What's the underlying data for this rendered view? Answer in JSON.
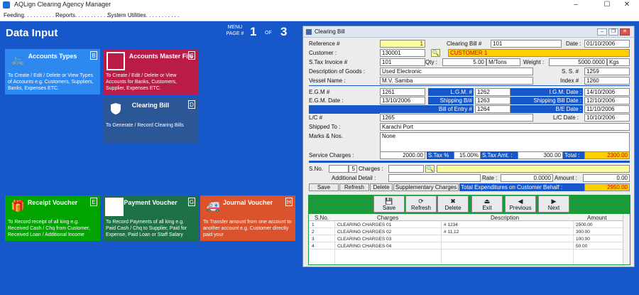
{
  "app": {
    "title": "AQLign Clearing Agency Manager"
  },
  "window_controls": {
    "minimize": "–",
    "maximize": "☐",
    "close": "✕"
  },
  "menu": [
    "Feeding. . . . . . . . . . .",
    "Reports. . . . . . . . . . .",
    "System Utilities. . . . . . . . . . ."
  ],
  "desktop": {
    "title": "Data Input",
    "menu_label": "MENU",
    "page_label": "PAGE #",
    "page_num": "1",
    "of_label": "OF",
    "page_total": "3",
    "background": "#1657c9"
  },
  "tiles": [
    {
      "title": "Accounts Types",
      "key": "B",
      "desc": "To Create / Edit / Delete or View Types of Accounts e.g. Customers, Suppliers, Banks, Expenses ETC.",
      "color": "#2d89ef",
      "icon": "bicycle-icon"
    },
    {
      "title": "Accounts Master File",
      "key": "C",
      "desc": "To Create / Edit / Delete or View Accounts for Banks, Customers, Supplier, Expenses ETC.",
      "color": "#b91d47",
      "icon": "blank-square-icon"
    },
    {
      "title": "Clearing Bill",
      "key": "D",
      "desc": "To Generate / Record Clearing Bills",
      "color": "#2b5797",
      "icon": "shield-icon"
    },
    {
      "title": "Receipt Voucher",
      "key": "E",
      "desc": "To Record receipt of all king e.g. Received Cash / Chq from Customer, Received Loan / Additional Income",
      "color": "#00a300",
      "icon": "gift-icon"
    },
    {
      "title": "Payment Voucher",
      "key": "G",
      "desc": "To Record Payments of all king e.g. Paid Cash / Chq to Supplier, Paid for Expense, Paid Loan or Staff Salary",
      "color": "#1e7145",
      "icon": "blank-square-icon"
    },
    {
      "title": "Journal Voucher",
      "key": "H",
      "desc": "To Transfer amount from one account to another account e.g. Customer directly paid your",
      "color": "#da532c",
      "icon": "ambulance-icon"
    }
  ],
  "bill": {
    "window_title": "Clearing Bill",
    "labels": {
      "reference": "Reference #",
      "clearing_bill": "Clearing Bill #",
      "date": "Date :",
      "customer": "Customer :",
      "stax_invoice": "S.Tax Invoice #",
      "qty": "Qty :",
      "weight": "Weight :",
      "desc_goods": "Description of Goods :",
      "ss": "S. S. #",
      "vessel": "Vessel Name :",
      "index": "Index #",
      "egm": "E.G.M #",
      "lgm": "L.G.M. #",
      "igm_date": "I.G.M. Date :",
      "egm_date": "E.G.M. Date :",
      "shipping_b": "Shipping B/#",
      "shipping_bill_date": "Shipping Bill Date :",
      "bill_of_entry": "Bill of Entry #",
      "be_date": "B/E Date :",
      "lc": "L/C #",
      "lc_date": "L/C Date :",
      "shipped_to": "Shipped To :",
      "marks": "Marks & Nos.",
      "service_charges": "Service Charges :",
      "stax_pct": "S.Tax %",
      "stax_amt": "S.Tax Amt. :",
      "total": "Total :",
      "sno": "S.No.",
      "charges": "Charges :",
      "additional_detail": "Additional Detail :",
      "rate": "Rate :",
      "amount": "Amount :",
      "total_exp": "Total Expenditures on Customer Behalf :"
    },
    "values": {
      "reference": "1",
      "clearing_bill": "101",
      "date": "01/10/2006",
      "customer_code": "130001",
      "customer_name": "CUSTOMER 1",
      "stax_invoice": "101",
      "qty": "5.00",
      "qty_unit": "M/Tons",
      "weight": "5000.0000",
      "weight_unit": "Kgs",
      "desc_goods": "Used Electronic",
      "ss": "1259",
      "vessel": "M.V. Samba",
      "index": "1260",
      "egm": "1261",
      "lgm": "1262",
      "igm_date": "14/10/2006",
      "egm_date": "13/10/2006",
      "shipping_b": "1263",
      "shipping_bill_date": "12/10/2006",
      "bill_of_entry": "1264",
      "be_date": "11/10/2006",
      "lc": "1265",
      "lc_date": "10/10/2006",
      "shipped_to": "Karachi Port",
      "marks": "None",
      "service_charges": "2000.00",
      "stax_pct": "15.00%",
      "stax_amt": "300.00",
      "total": "2300.00",
      "sno": "5",
      "rate": "0.0000",
      "amount": "0.00",
      "total_exp": "2950.00"
    },
    "small_buttons": [
      "Save",
      "Refresh",
      "Delete",
      "Supplementary Charges"
    ],
    "toolbar": [
      {
        "label": "Save",
        "icon": "save-icon",
        "glyph": "💾"
      },
      {
        "label": "Refresh",
        "icon": "refresh-icon",
        "glyph": "⟳"
      },
      {
        "label": "Delete",
        "icon": "delete-icon",
        "glyph": "✖"
      },
      {
        "label": "Exit",
        "icon": "exit-icon",
        "glyph": "⏏"
      },
      {
        "label": "Previous",
        "icon": "previous-icon",
        "glyph": "◀"
      },
      {
        "label": "Next",
        "icon": "next-icon",
        "glyph": "▶"
      }
    ],
    "grid": {
      "headers": [
        "S.No.",
        "Charges",
        "Description",
        "Amount"
      ],
      "rows": [
        [
          "1",
          "CLEARING CHARGES 01",
          "# 1234",
          "2500.00"
        ],
        [
          "2",
          "CLEARING CHARGES 02",
          "# 11,12",
          "300.00"
        ],
        [
          "3",
          "CLEARING CHARGES 03",
          "",
          "100.00"
        ],
        [
          "4",
          "CLEARING CHARGES 04",
          "",
          "50.00"
        ]
      ]
    }
  }
}
